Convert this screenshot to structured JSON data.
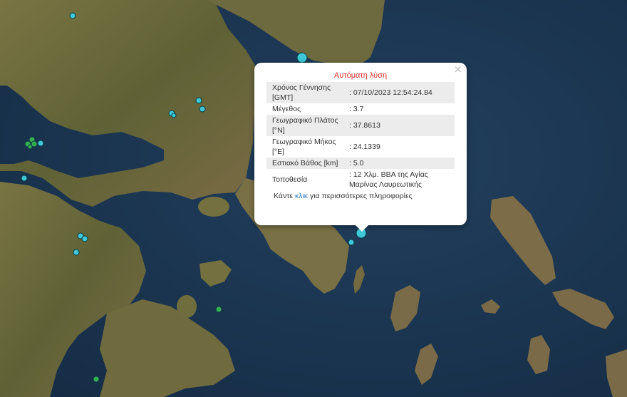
{
  "popup": {
    "title": "Αυτόματη λύση",
    "close_symbol": "×",
    "rows": [
      {
        "label": "Χρόνος Γέννησης [GMT]",
        "value": ": 07/10/2023 12:54:24.84"
      },
      {
        "label": "Μέγεθος",
        "value": ": 3.7"
      },
      {
        "label": "Γεωγραφικό Πλάτος [°N]",
        "value": ": 37.8613"
      },
      {
        "label": "Γεωγραφικό Μήκος [°E]",
        "value": ": 24.1339"
      },
      {
        "label": "Εστιακό Βάθος [km]",
        "value": ": 5.0"
      },
      {
        "label": "Τοποθεσία",
        "value": ": 12 Χλμ. ΒΒΑ της Αγίας Μαρίνας Λαυρεωτικής"
      }
    ],
    "more_prefix": "Κάντε ",
    "more_link": "κλικ",
    "more_suffix": " για περισσότερες πληροφορίες"
  },
  "colors": {
    "sea": "#1b3550",
    "land": "#6d6a3e",
    "quake_cyan": "#3ec8d8",
    "quake_green": "#35b04f",
    "title_red": "#e5312b",
    "link_blue": "#2a7ac0"
  }
}
